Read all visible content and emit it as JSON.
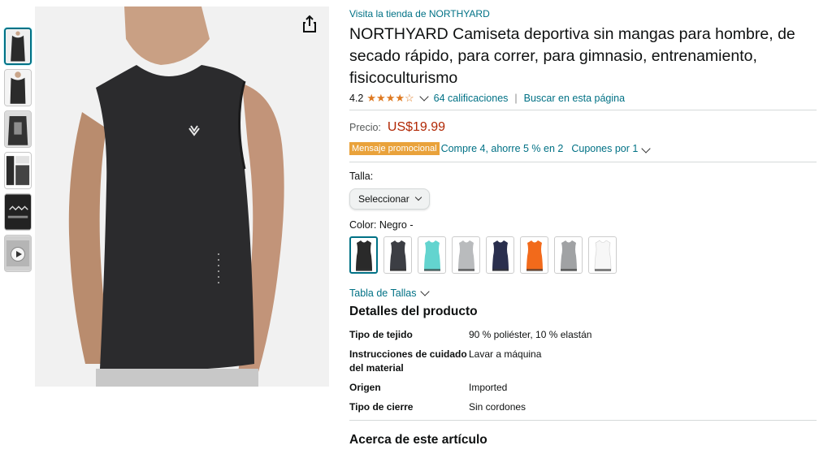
{
  "share_icon": "share-icon",
  "store_link": "Visita la tienda de NORTHYARD",
  "title": "NORTHYARD Camiseta deportiva sin mangas para hombre, de secado rápido, para correr, para gimnasio, entrenamiento, fisicoculturismo",
  "rating": {
    "value": "4.2",
    "stars": "★★★★☆",
    "count_text": "64 calificaciones",
    "separator": "|",
    "search_link": "Buscar en esta página"
  },
  "price": {
    "label": "Precio:",
    "value": "US$19.99"
  },
  "promo": {
    "badge": "Mensaje promocional",
    "text": "Compre 4, ahorre 5 % en 2",
    "coupons": "Cupones por 1"
  },
  "size": {
    "label": "Talla:",
    "select_value": "Seleccionar"
  },
  "color": {
    "label": "Color:",
    "selected": "Negro -",
    "swatches": [
      "#2a2a2a",
      "#3c3e44",
      "#63d4cf",
      "#b9bbbd",
      "#2a2f4e",
      "#f26a1b",
      "#a0a2a4",
      "#f7f7f7"
    ]
  },
  "size_chart_link": "Tabla de Tallas",
  "details": {
    "heading": "Detalles del producto",
    "rows": [
      {
        "key": "Tipo de tejido",
        "value": "90 % poliéster, 10 % elastán"
      },
      {
        "key": "Instrucciones de cuidado del material",
        "value": "Lavar a máquina"
      },
      {
        "key": "Origen",
        "value": "Imported"
      },
      {
        "key": "Tipo de cierre",
        "value": "Sin cordones"
      }
    ]
  },
  "about_heading": "Acerca de este artículo"
}
